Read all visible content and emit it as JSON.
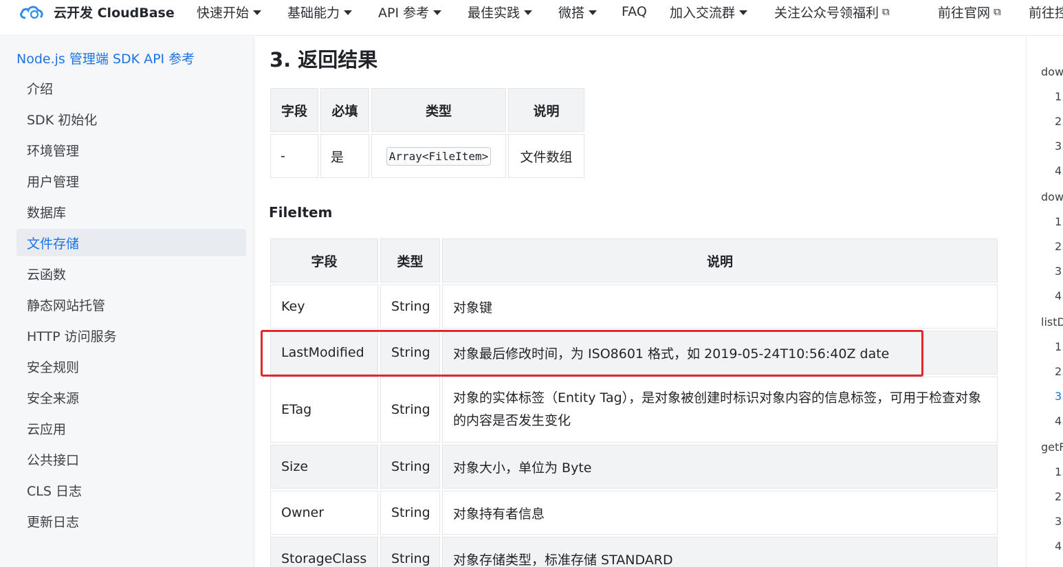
{
  "header": {
    "brand": "云开发 CloudBase",
    "nav": [
      {
        "label": "快速开始",
        "dropdown": true
      },
      {
        "label": "基础能力",
        "dropdown": true
      },
      {
        "label": "API 参考",
        "dropdown": true
      },
      {
        "label": "最佳实践",
        "dropdown": true
      },
      {
        "label": "微搭",
        "dropdown": true
      },
      {
        "label": "FAQ",
        "dropdown": false
      },
      {
        "label": "加入交流群",
        "dropdown": true
      },
      {
        "label": "关注公众号领福利",
        "external": true
      },
      {
        "label": "前往官网",
        "external": true
      },
      {
        "label": "前往控",
        "external": false
      }
    ]
  },
  "sidebar": {
    "title": "Node.js 管理端 SDK API 参考",
    "items": [
      {
        "label": "介绍"
      },
      {
        "label": "SDK 初始化"
      },
      {
        "label": "环境管理"
      },
      {
        "label": "用户管理"
      },
      {
        "label": "数据库"
      },
      {
        "label": "文件存储",
        "active": true
      },
      {
        "label": "云函数"
      },
      {
        "label": "静态网站托管"
      },
      {
        "label": "HTTP 访问服务"
      },
      {
        "label": "安全规则"
      },
      {
        "label": "安全来源"
      },
      {
        "label": "云应用"
      },
      {
        "label": "公共接口"
      },
      {
        "label": "CLS 日志"
      },
      {
        "label": "更新日志"
      }
    ]
  },
  "content": {
    "section_title": "3. 返回结果",
    "result_table": {
      "headers": [
        "字段",
        "必填",
        "类型",
        "说明"
      ],
      "row": {
        "field": "-",
        "required": "是",
        "type": "Array<FileItem>",
        "desc": "文件数组"
      }
    },
    "fileitem_title": "FileItem",
    "fileitem_table": {
      "headers": [
        "字段",
        "类型",
        "说明"
      ],
      "rows": [
        {
          "field": "Key",
          "type": "String",
          "desc": "对象键"
        },
        {
          "field": "LastModified",
          "type": "String",
          "desc": "对象最后修改时间，为 ISO8601 格式，如 2019-05-24T10:56:40Z date"
        },
        {
          "field": "ETag",
          "type": "String",
          "desc": "对象的实体标签（Entity Tag），是对象被创建时标识对象内容的信息标签，可用于检查对象的内容是否发生变化"
        },
        {
          "field": "Size",
          "type": "String",
          "desc": "对象大小，单位为 Byte"
        },
        {
          "field": "Owner",
          "type": "String",
          "desc": "对象持有者信息"
        },
        {
          "field": "StorageClass",
          "type": "String",
          "desc": "对象存储类型，标准存储 STANDARD"
        }
      ]
    }
  },
  "toc": {
    "items": [
      {
        "label": "dow"
      },
      {
        "label": "1."
      },
      {
        "label": "2."
      },
      {
        "label": "3."
      },
      {
        "label": "4."
      },
      {
        "label": "dow"
      },
      {
        "label": "1."
      },
      {
        "label": "2."
      },
      {
        "label": "3."
      },
      {
        "label": "4."
      },
      {
        "label": "listD"
      },
      {
        "label": "1."
      },
      {
        "label": "2."
      },
      {
        "label": "3.",
        "active": true
      },
      {
        "label": "4."
      },
      {
        "label": "getF"
      },
      {
        "label": "1."
      },
      {
        "label": "2."
      },
      {
        "label": "3."
      },
      {
        "label": "4."
      }
    ]
  },
  "colors": {
    "accent": "#1a73e8",
    "highlight_box": "#e8242c"
  }
}
